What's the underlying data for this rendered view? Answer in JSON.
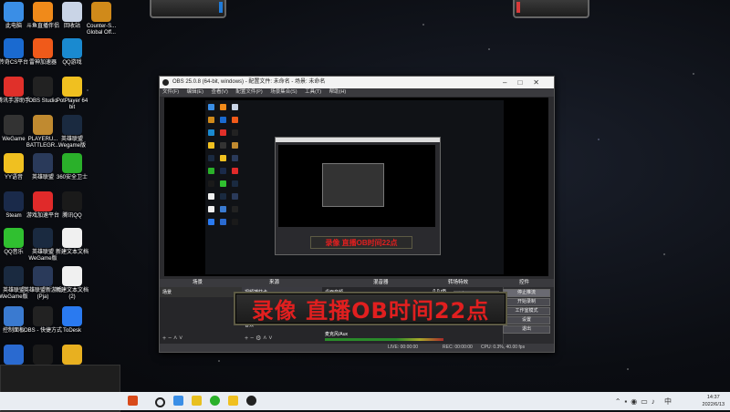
{
  "desktop": {
    "icons": [
      {
        "label": "此电脑",
        "color": "#3a8ee6"
      },
      {
        "label": "斗鱼直播伴侣",
        "color": "#f08a1a"
      },
      {
        "label": "回收站",
        "color": "#c9d4e6"
      },
      {
        "label": "Counter-S... Global Off...",
        "color": "#d08a1a"
      },
      {
        "label": "传奇CS平台",
        "color": "#1a6ad0"
      },
      {
        "label": "雷神加速器",
        "color": "#f05a1a"
      },
      {
        "label": "QQ游戏",
        "color": "#1a8ad0"
      },
      {
        "label": "腾讯手游助手",
        "color": "#e0302a"
      },
      {
        "label": "OBS Studio",
        "color": "#222"
      },
      {
        "label": "PotPlayer 64 bit",
        "color": "#f0c020"
      },
      {
        "label": "WeGame",
        "color": "#333"
      },
      {
        "label": "PLAYERU... BATTLEGR...",
        "color": "#c08a30"
      },
      {
        "label": "英雄联盟 Wegame版",
        "color": "#1a2a40"
      },
      {
        "label": "YY语音",
        "color": "#f0c020"
      },
      {
        "label": "英雄联盟",
        "color": "#2a3a5a"
      },
      {
        "label": "360安全卫士",
        "color": "#2ab02a"
      },
      {
        "label": "Steam",
        "color": "#1a2a4a"
      },
      {
        "label": "游戏加速平台",
        "color": "#e02a2a"
      },
      {
        "label": "腾讯QQ",
        "color": "#1a1a1a"
      },
      {
        "label": "QQ音乐",
        "color": "#30c030"
      },
      {
        "label": "英雄联盟 WeGame版",
        "color": "#1a2a40"
      },
      {
        "label": "新建文本文档",
        "color": "#f0f0f0"
      },
      {
        "label": "英雄联盟 WeGame版",
        "color": "#1a2a40"
      },
      {
        "label": "英雄联盟新游戏 (Pja)",
        "color": "#2a3a5a"
      },
      {
        "label": "新建文本文档 (2)",
        "color": "#f0f0f0"
      },
      {
        "label": "控制面板",
        "color": "#3a7ad0"
      },
      {
        "label": "OBS - 快捷方式",
        "color": "#222"
      },
      {
        "label": "ToDesk",
        "color": "#2a7af0"
      },
      {
        "label": "",
        "color": "#2a6ad0"
      },
      {
        "label": "",
        "color": "#1a1a1a"
      },
      {
        "label": "",
        "color": "#e8b020"
      }
    ]
  },
  "obs": {
    "title": "OBS 25.0.8 (64-bit, windows) - 配置文件: 未命名 - 场景: 未命名",
    "menu": [
      "文件(F)",
      "编辑(E)",
      "查看(V)",
      "配置文件(P)",
      "场景集合(S)",
      "工具(T)",
      "帮助(H)"
    ],
    "docks": [
      "场景",
      "来源",
      "混音器",
      "转场特效",
      "控件"
    ],
    "scene_item": "场景",
    "source_item": "视频捕获卡",
    "mixer_track": "桌面音频",
    "mixer_level": "0.0 dB",
    "mixer_track2": "麦克风/Aux",
    "audio_label": "音频",
    "transition": "淡出",
    "controls": [
      "停止推流",
      "开始录制",
      "工作室模式",
      "设置",
      "退出"
    ],
    "status_items": [
      "LIVE: 00:00:00",
      "REC: 00:00:00",
      "CPU: 0.3%, 40.00 fps"
    ]
  },
  "overlay": {
    "text": "录像 直播OB时间22点",
    "color": "#e11f1f"
  },
  "taskbar": {
    "time": "14:37",
    "date": "2022/6/13",
    "icons": [
      "#d84a1a",
      "#3a8ee6",
      "#2ab02a",
      "#f0c020",
      "#222",
      "#e8b020"
    ]
  }
}
